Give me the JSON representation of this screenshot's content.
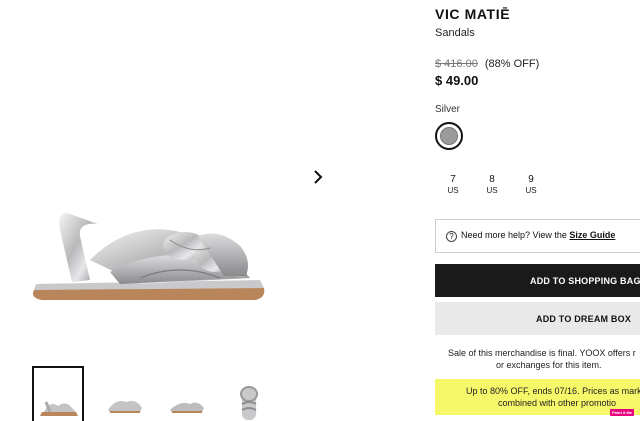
{
  "product": {
    "brand": "VIC MATIĒ",
    "category": "Sandals",
    "old_price": "$ 416.00",
    "discount": "(88% OFF)",
    "price": "$ 49.00",
    "color_label": "Silver",
    "color_swatch": "#9a9a9a"
  },
  "gallery": {
    "main_image": "silver-knotted-sandal",
    "next_icon": "chevron-right-icon",
    "thumbnails": [
      "sandal-side-view",
      "sandal-front-view",
      "sandal-angle-view",
      "sandal-top-view"
    ]
  },
  "sizes": [
    {
      "value": "7",
      "unit": "US"
    },
    {
      "value": "8",
      "unit": "US"
    },
    {
      "value": "9",
      "unit": "US"
    }
  ],
  "help": {
    "icon": "question-circle-icon",
    "text": "Need more help? View the ",
    "link": "Size Guide"
  },
  "buttons": {
    "add_to_bag": "ADD TO SHOPPING BAG",
    "add_to_dream_box": "ADD TO DREAM BOX"
  },
  "final_sale": {
    "line1": "Sale of this merchandise is final. YOOX offers r",
    "line2": "or exchanges for this item."
  },
  "promo": {
    "line1": "Up to 80% OFF, ends 07/16. Prices as mark",
    "line2": "combined with other promotio",
    "badge": "Paint it Me",
    "background": "#f7f76a"
  }
}
